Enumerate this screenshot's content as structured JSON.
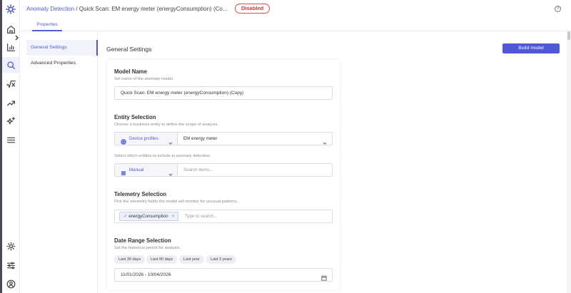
{
  "header": {
    "breadcrumb_link": "Anomaly Detection",
    "breadcrumb_separator": "/",
    "breadcrumb_current": "Quick Scan: EM energy meter (energyConsumption) (Co...",
    "status_badge": "Disabled",
    "help_icon": "question-circle-icon"
  },
  "tabs": [
    {
      "label": "Properties",
      "active": true
    }
  ],
  "sidebar_menu": [
    {
      "label": "General Settings",
      "active": true
    },
    {
      "label": "Advanced Properties",
      "active": false
    }
  ],
  "rail_icons": [
    "logo-icon",
    "home-icon",
    "bar-chart-icon",
    "search-icon",
    "sqrt-icon",
    "trend-icon",
    "sparkles-icon",
    "menu-icon",
    "gear-icon",
    "sliders-icon",
    "user-icon"
  ],
  "main": {
    "title": "General Settings",
    "build_button": "Build model",
    "model_name": {
      "title": "Model Name",
      "description": "Set name of the anomaly model.",
      "value": "Quick Scan: EM energy meter (energyConsumption) (Copy)"
    },
    "entity_selection": {
      "title": "Entity Selection",
      "description": "Choose a business entity to define the scope of analysis.",
      "entity_type": "Device profiles",
      "entity_value": "EM energy meter",
      "include_description": "Select which entities to include in anomaly detection.",
      "include_mode": "Manual",
      "search_placeholder": "Search items..."
    },
    "telemetry_selection": {
      "title": "Telemetry Selection",
      "description": "Pick the telemetry fields the model will monitor for unusual patterns.",
      "chip": "energyConsumption",
      "chip_remove": "×",
      "search_placeholder": "Type to search..."
    },
    "date_range": {
      "title": "Date Range Selection",
      "description": "Set the historical period for analysis.",
      "presets": [
        "Last 30 days",
        "Last 90 days",
        "Last year",
        "Last 3 years"
      ],
      "value": "11/01/2026 - 10/04/2026"
    }
  },
  "colors": {
    "accent": "#4f59d6",
    "danger": "#d23b3b"
  }
}
